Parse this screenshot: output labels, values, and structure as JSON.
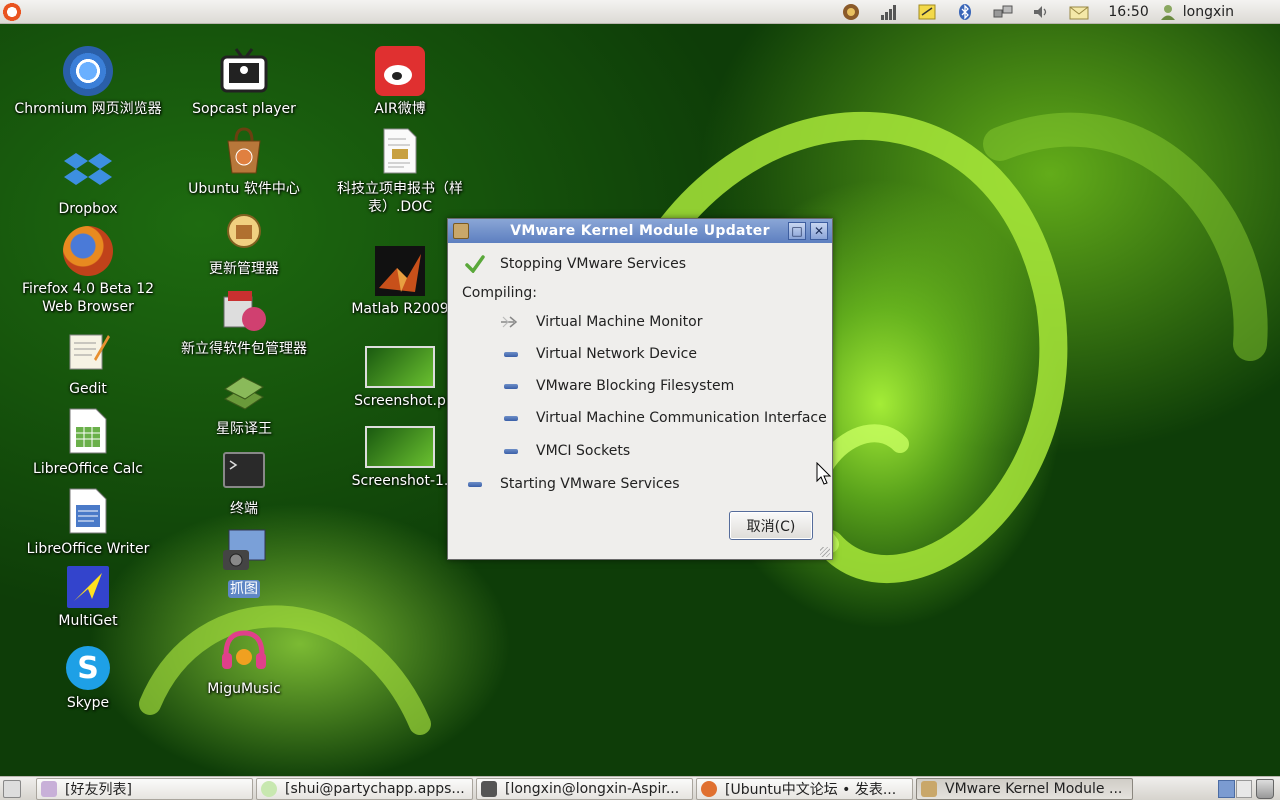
{
  "top_panel": {
    "clock": "16:50",
    "user": "longxin",
    "tray_icons": [
      "shield-icon",
      "signal-icon",
      "notes-icon",
      "bluetooth-icon",
      "network-icon",
      "volume-icon",
      "mail-icon"
    ]
  },
  "desktop": {
    "icons": [
      {
        "label": "Chromium 网页浏览器",
        "icon": "chromium-icon",
        "color": "#3b7fd8"
      },
      {
        "label": "Dropbox",
        "icon": "dropbox-icon",
        "color": "#3d8fe0"
      },
      {
        "label": "Firefox 4.0 Beta 12 Web Browser",
        "icon": "firefox-icon",
        "color": "#e06a1a"
      },
      {
        "label": "Gedit",
        "icon": "gedit-icon",
        "color": "#f1efe4"
      },
      {
        "label": "LibreOffice Calc",
        "icon": "calc-icon",
        "color": "#eaf4e6"
      },
      {
        "label": "LibreOffice Writer",
        "icon": "writer-icon",
        "color": "#e6eef8"
      },
      {
        "label": "MultiGet",
        "icon": "multiget-icon",
        "color": "#3344cc"
      },
      {
        "label": "Skype",
        "icon": "skype-icon",
        "color": "#1ea0e6"
      },
      {
        "label": "Sopcast player",
        "icon": "sopcast-icon",
        "color": "#ffffff"
      },
      {
        "label": "Ubuntu 软件中心",
        "icon": "software-center-icon",
        "color": "#b8773a"
      },
      {
        "label": "更新管理器",
        "icon": "update-manager-icon",
        "color": "#e8c060"
      },
      {
        "label": "新立得软件包管理器",
        "icon": "synaptic-icon",
        "color": "#c83030"
      },
      {
        "label": "星际译王",
        "icon": "stardict-icon",
        "color": "#5a8a3a"
      },
      {
        "label": "终端",
        "icon": "terminal-icon",
        "color": "#2a2a2a"
      },
      {
        "label": "抓图",
        "icon": "screenshot-icon",
        "color": "#4a6fa8"
      },
      {
        "label": "MiguMusic",
        "icon": "migumusic-icon",
        "color": "#e0408a"
      },
      {
        "label": "AIR微博",
        "icon": "weibo-icon",
        "color": "#e03030"
      },
      {
        "label": "科技立项申报书（样表）.DOC",
        "icon": "document-icon",
        "color": "#f4f4f4"
      },
      {
        "label": "Matlab R2009",
        "icon": "matlab-icon",
        "color": "#c8501a"
      },
      {
        "label": "Screenshot.p",
        "icon": "image-thumb-icon",
        "color": "#2f7a1a"
      },
      {
        "label": "Screenshot-1.",
        "icon": "image-thumb-icon",
        "color": "#2f7a1a"
      }
    ]
  },
  "dialog": {
    "title": "VMware Kernel Module Updater",
    "stopping": "Stopping VMware Services",
    "compiling_label": "Compiling:",
    "compile_items": [
      "Virtual Machine Monitor",
      "Virtual Network Device",
      "VMware Blocking Filesystem",
      "Virtual Machine Communication Interface",
      "VMCI Sockets"
    ],
    "starting": "Starting VMware Services",
    "cancel_label": "取消(C)"
  },
  "taskbar": {
    "tasks": [
      {
        "label": "[好友列表]",
        "color": "#c8b0d8"
      },
      {
        "label": "[shui@partychapp.apps...",
        "color": "#c8e8b0"
      },
      {
        "label": "[longxin@longxin-Aspir...",
        "color": "#555555"
      },
      {
        "label": "[Ubuntu中文论坛 • 发表...",
        "color": "#e07030"
      },
      {
        "label": "VMware Kernel Module ...",
        "color": "#c9a76a"
      }
    ]
  }
}
